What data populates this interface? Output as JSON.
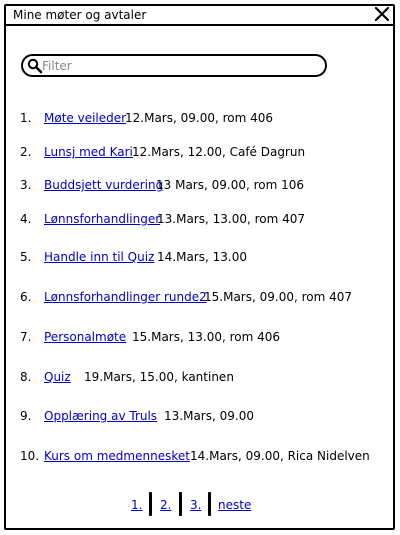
{
  "window": {
    "title": "Mine møter og avtaler"
  },
  "filter": {
    "placeholder": "Filter",
    "value": ""
  },
  "meetings": [
    {
      "number": "1.",
      "title": "Møte veileder",
      "info": "12.Mars, 09.00, rom 406"
    },
    {
      "number": "2.",
      "title": "Lunsj med Kari",
      "info": "12.Mars, 12.00, Café Dagrun"
    },
    {
      "number": "3.",
      "title": "Buddsjett vurdering",
      "info": "13 Mars, 09.00, rom 106"
    },
    {
      "number": "4.",
      "title": "Lønnsforhandlinger",
      "info": "13.Mars, 13.00, rom 407"
    },
    {
      "number": "5.",
      "title": "Handle inn til Quiz",
      "info": "14.Mars, 13.00"
    },
    {
      "number": "6.",
      "title": "Lønnsforhandlinger runde2",
      "info": "15.Mars, 09.00, rom 407"
    },
    {
      "number": "7.",
      "title": "Personalmøte",
      "info": "15.Mars, 13.00, rom 406"
    },
    {
      "number": "8.",
      "title": "Quiz",
      "info": "19.Mars, 15.00, kantinen"
    },
    {
      "number": "9.",
      "title": "Opplæring av Truls",
      "info": "13.Mars, 09.00"
    },
    {
      "number": "10.",
      "title": "Kurs om medmennesket",
      "info": "14.Mars, 09.00, Rica Nidelven"
    }
  ],
  "pagination": {
    "pages": [
      "1.",
      "2.",
      "3."
    ],
    "next": "neste"
  }
}
